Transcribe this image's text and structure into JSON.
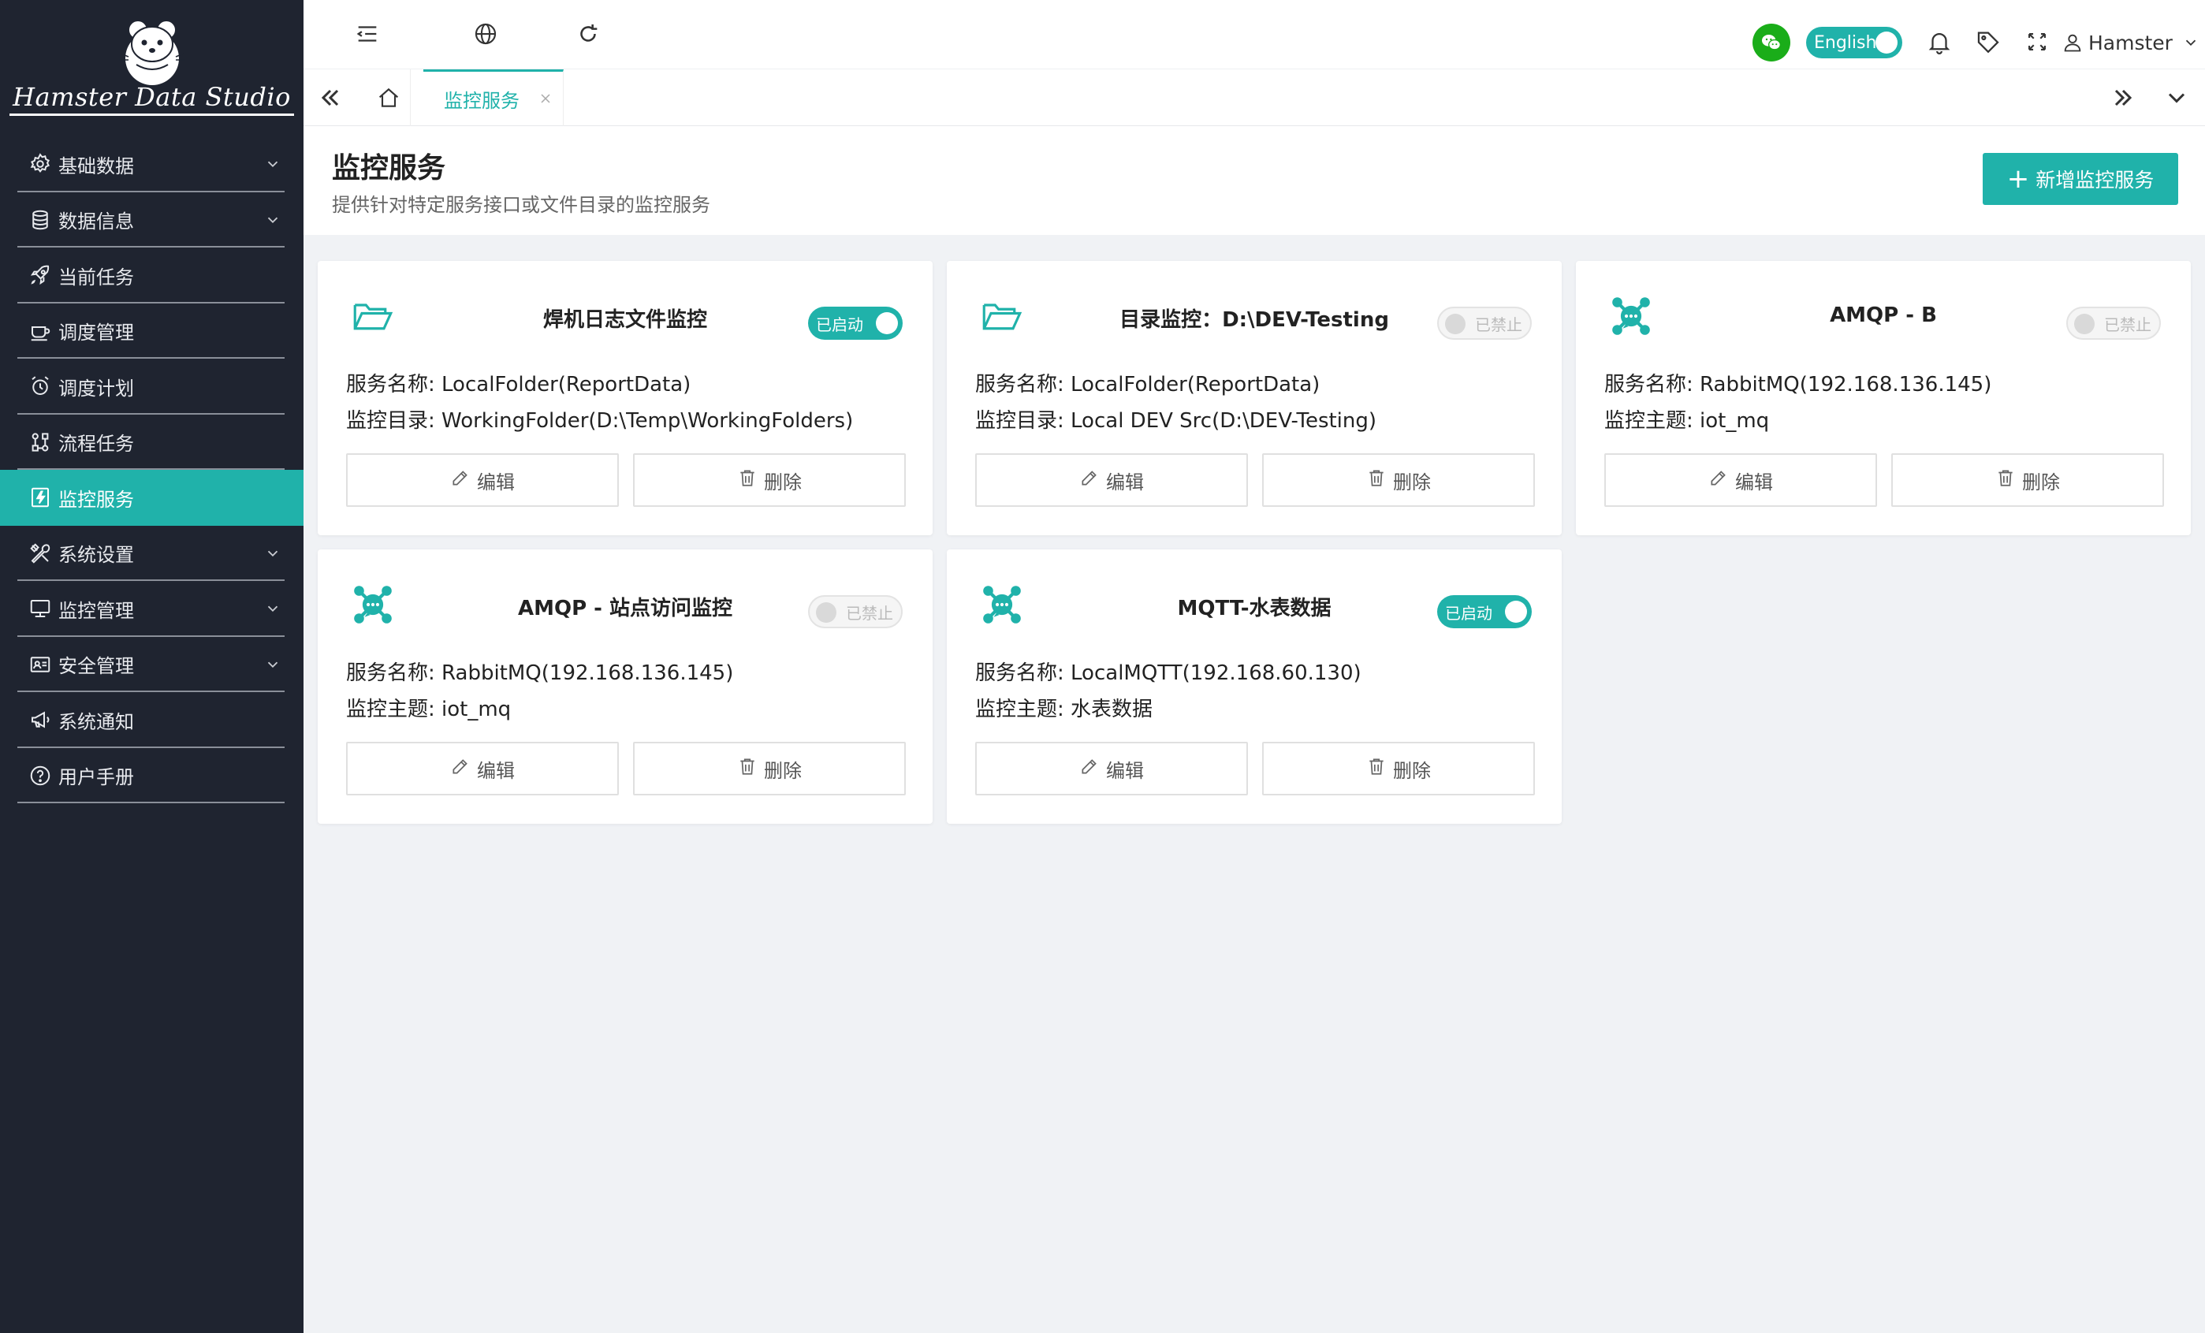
{
  "app": {
    "logo_text": "Hamster Data Studio",
    "accent_color": "#20b2aa",
    "sidebar_color": "#1f2430"
  },
  "sidebar": {
    "items": [
      {
        "label": "基础数据",
        "icon": "gear-icon",
        "has_children": true
      },
      {
        "label": "数据信息",
        "icon": "database-icon",
        "has_children": true
      },
      {
        "label": "当前任务",
        "icon": "rocket-icon",
        "has_children": false
      },
      {
        "label": "调度管理",
        "icon": "cup-icon",
        "has_children": false
      },
      {
        "label": "调度计划",
        "icon": "alarm-clock-icon",
        "has_children": false
      },
      {
        "label": "流程任务",
        "icon": "flow-icon",
        "has_children": false
      },
      {
        "label": "监控服务",
        "icon": "lightning-icon",
        "has_children": false,
        "active": true
      },
      {
        "label": "系统设置",
        "icon": "tools-icon",
        "has_children": true
      },
      {
        "label": "监控管理",
        "icon": "monitor-icon",
        "has_children": true
      },
      {
        "label": "安全管理",
        "icon": "id-card-icon",
        "has_children": true
      },
      {
        "label": "系统通知",
        "icon": "megaphone-icon",
        "has_children": false
      },
      {
        "label": "用户手册",
        "icon": "question-icon",
        "has_children": false
      }
    ]
  },
  "topbar": {
    "language_label": "English",
    "language_on": true,
    "username": "Hamster"
  },
  "tabs": {
    "active_label": "监控服务"
  },
  "page": {
    "title": "监控服务",
    "subtitle": "提供针对特定服务接口或文件目录的监控服务",
    "add_button_label": "新增监控服务"
  },
  "cards": [
    {
      "title": "焊机日志文件监控",
      "icon": "folder-open-icon",
      "enabled": true,
      "status_label": "已启动",
      "line1": "服务名称: LocalFolder(ReportData)",
      "line2": "监控目录: WorkingFolder(D:\\Temp\\WorkingFolders)",
      "edit_label": "编辑",
      "delete_label": "删除"
    },
    {
      "title": "目录监控：D:\\DEV-Testing",
      "icon": "folder-open-icon",
      "enabled": false,
      "status_label": "已禁止",
      "line1": "服务名称: LocalFolder(ReportData)",
      "line2": "监控目录: Local DEV Src(D:\\DEV-Testing)",
      "edit_label": "编辑",
      "delete_label": "删除"
    },
    {
      "title": "AMQP - B",
      "icon": "message-hub-icon",
      "enabled": false,
      "status_label": "已禁止",
      "line1": "服务名称: RabbitMQ(192.168.136.145)",
      "line2": "监控主题: iot_mq",
      "edit_label": "编辑",
      "delete_label": "删除"
    },
    {
      "title": "AMQP - 站点访问监控",
      "icon": "message-hub-icon",
      "enabled": false,
      "status_label": "已禁止",
      "line1": "服务名称: RabbitMQ(192.168.136.145)",
      "line2": "监控主题: iot_mq",
      "edit_label": "编辑",
      "delete_label": "删除"
    },
    {
      "title": "MQTT-水表数据",
      "icon": "message-hub-icon",
      "enabled": true,
      "status_label": "已启动",
      "line1": "服务名称: LocalMQTT(192.168.60.130)",
      "line2": "监控主题: 水表数据",
      "edit_label": "编辑",
      "delete_label": "删除"
    }
  ]
}
